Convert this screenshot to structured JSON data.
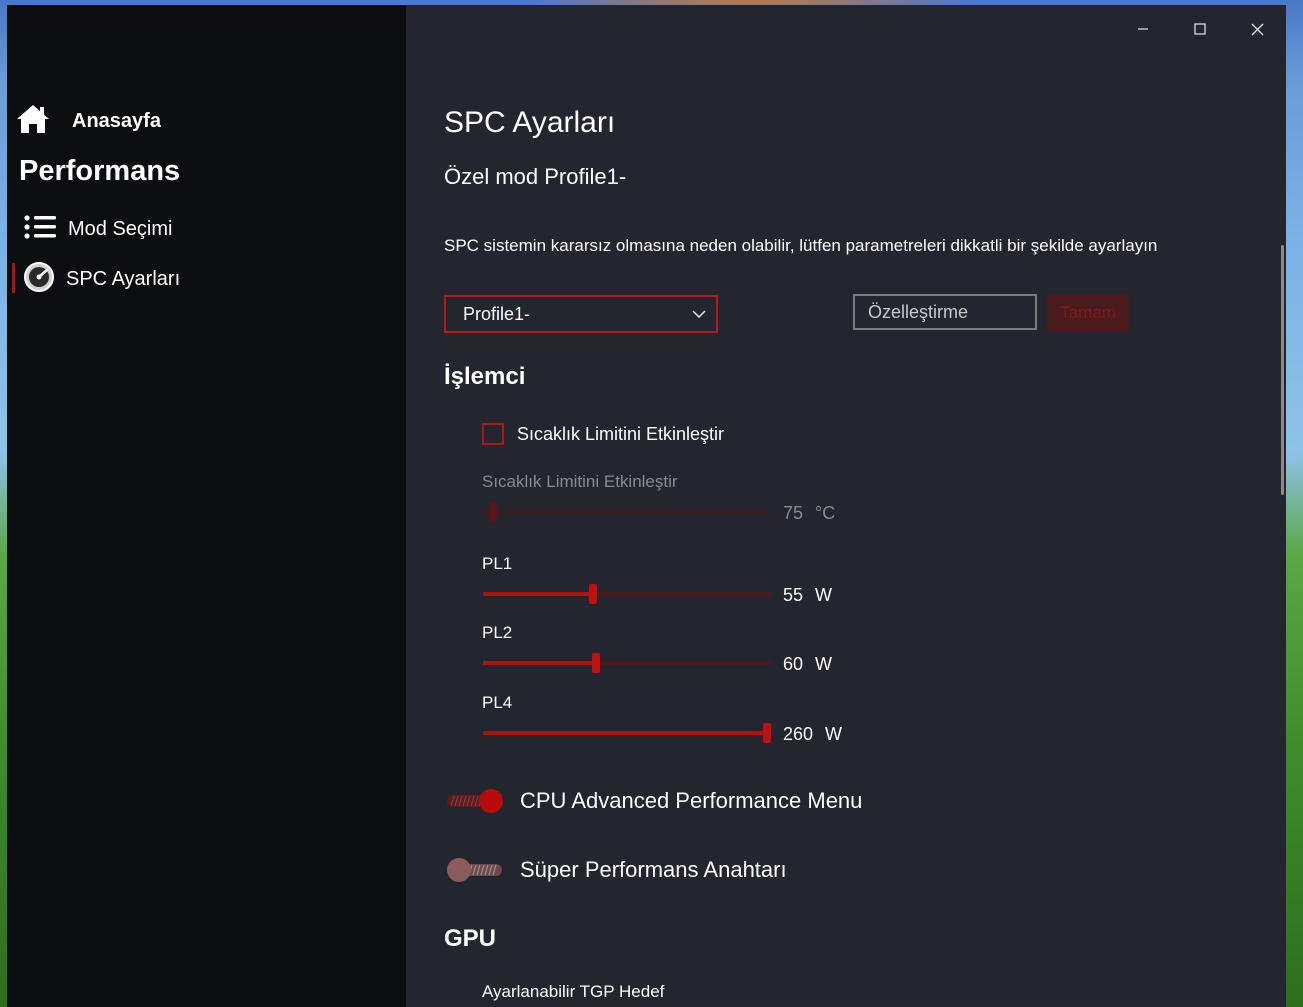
{
  "window_controls": {
    "minimize": "—",
    "maximize": "☐",
    "close": "✕"
  },
  "sidebar": {
    "home_label": "Anasayfa",
    "section_title": "Performans",
    "items": [
      {
        "label": "Mod Seçimi",
        "icon": "list-icon"
      },
      {
        "label": "SPC Ayarları",
        "icon": "speedometer-icon",
        "active": true
      }
    ]
  },
  "main": {
    "page_title": "SPC Ayarları",
    "subtitle": "Özel mod Profile1-",
    "warning": "SPC sistemin kararsız olmasına neden olabilir, lütfen parametreleri dikkatli bir şekilde ayarlayın",
    "profile_select": {
      "value": "Profile1-"
    },
    "custom_name": {
      "placeholder": "Özelleştirme"
    },
    "ok_button": "Tamam",
    "cpu_section": "İşlemci",
    "temp_checkbox": {
      "label": "Sıcaklık Limitini Etkinleştir",
      "checked": false
    },
    "temp_slider": {
      "label": "Sıcaklık Limitini Etkinleştir",
      "value": "75",
      "unit": "°C",
      "fraction": 0.02,
      "enabled": false
    },
    "pl1": {
      "label": "PL1",
      "value": "55",
      "unit": "W",
      "fraction": 0.38
    },
    "pl2": {
      "label": "PL2",
      "value": "60",
      "unit": "W",
      "fraction": 0.39
    },
    "pl4": {
      "label": "PL4",
      "value": "260",
      "unit": "W",
      "fraction": 1.0
    },
    "cpu_advanced_toggle": {
      "label": "CPU Advanced Performance Menu",
      "on": true
    },
    "super_perf_toggle": {
      "label": "Süper Performans Anahtarı",
      "on": false
    },
    "gpu_section": "GPU",
    "tgp_label": "Ayarlanabilir TGP Hedef"
  },
  "colors": {
    "accent": "#c01010",
    "track_bg": "#4a1a1d",
    "sidebar_bg": "#0c0d10",
    "content_bg": "#23262e"
  }
}
